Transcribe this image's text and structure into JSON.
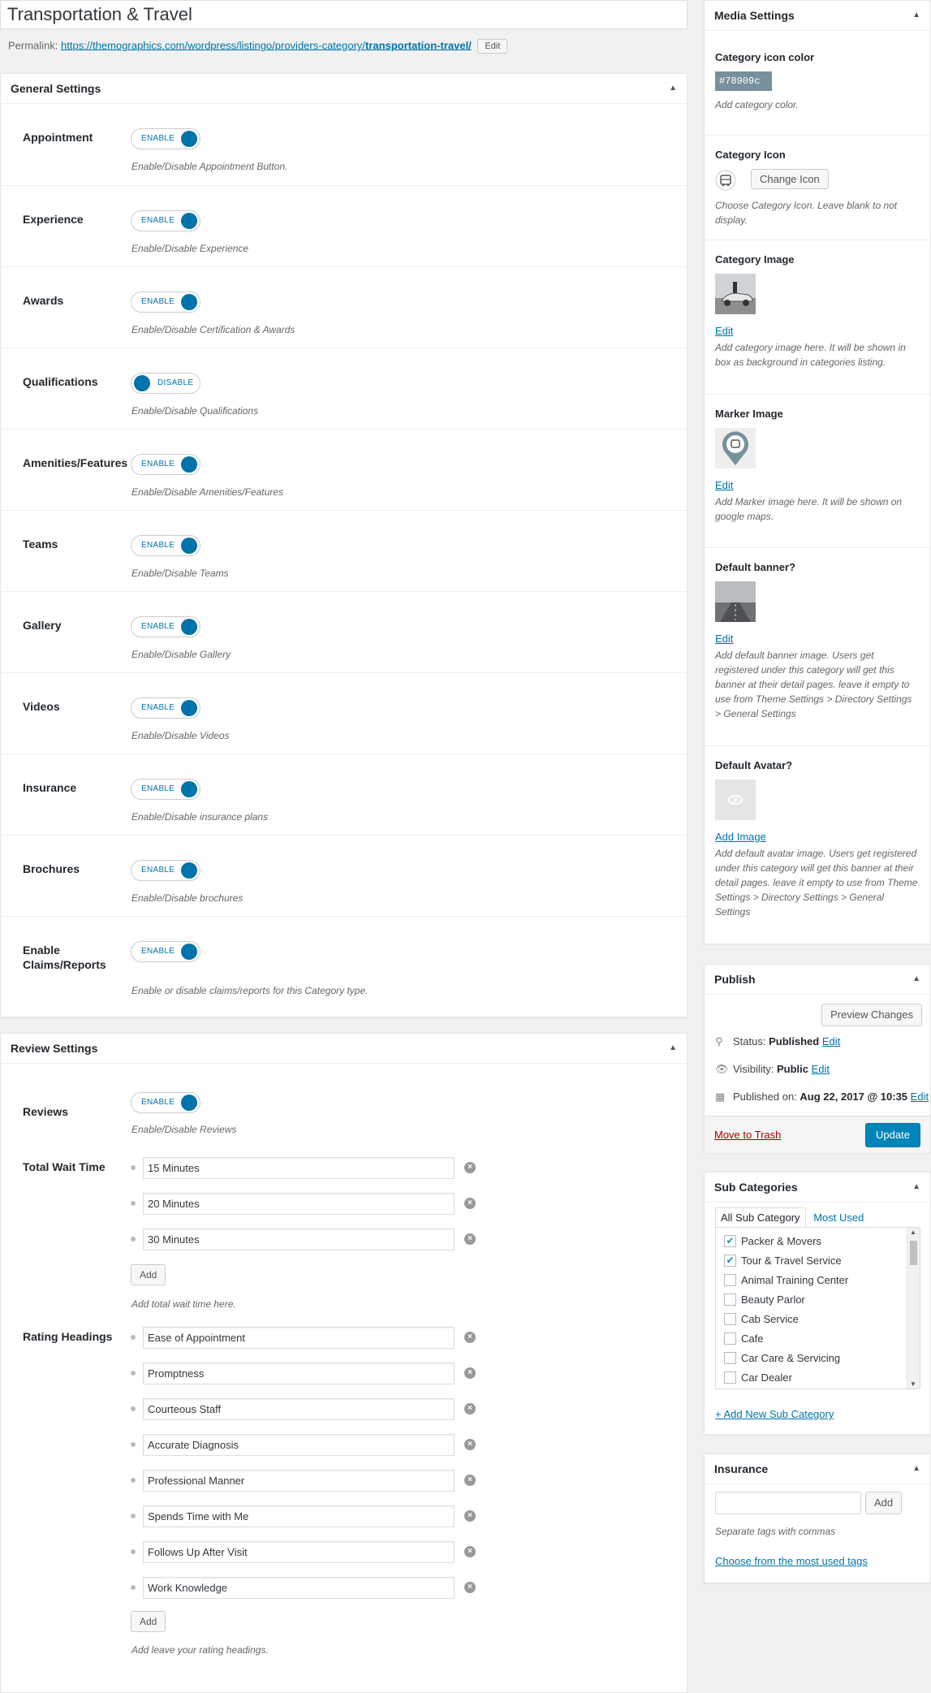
{
  "title": "Transportation & Travel",
  "permalink": {
    "label": "Permalink:",
    "url_base": "https://themographics.com/wordpress/listingo/providers-category/",
    "url_slug": "transportation-travel/",
    "edit_label": "Edit"
  },
  "general_settings": {
    "title": "General Settings",
    "rows": [
      {
        "label": "Appointment",
        "state": "ENABLE",
        "desc": "Enable/Disable Appointment Button."
      },
      {
        "label": "Experience",
        "state": "ENABLE",
        "desc": "Enable/Disable Experience"
      },
      {
        "label": "Awards",
        "state": "ENABLE",
        "desc": "Enable/Disable Certification & Awards"
      },
      {
        "label": "Qualifications",
        "state": "DISABLE",
        "desc": "Enable/Disable Qualifications"
      },
      {
        "label": "Amenities/Features",
        "state": "ENABLE",
        "desc": "Enable/Disable Amenities/Features"
      },
      {
        "label": "Teams",
        "state": "ENABLE",
        "desc": "Enable/Disable Teams"
      },
      {
        "label": "Gallery",
        "state": "ENABLE",
        "desc": "Enable/Disable Gallery"
      },
      {
        "label": "Videos",
        "state": "ENABLE",
        "desc": "Enable/Disable Videos"
      },
      {
        "label": "Insurance",
        "state": "ENABLE",
        "desc": "Enable/Disable insurance plans"
      },
      {
        "label": "Brochures",
        "state": "ENABLE",
        "desc": "Enable/Disable brochures"
      },
      {
        "label": "Enable Claims/Reports",
        "state": "ENABLE",
        "desc": "Enable or disable claims/reports for this Category type."
      }
    ]
  },
  "review_settings": {
    "title": "Review Settings",
    "reviews": {
      "label": "Reviews",
      "state": "ENABLE",
      "desc": "Enable/Disable Reviews"
    },
    "wait_time": {
      "label": "Total Wait Time",
      "items": [
        "15 Minutes",
        "20 Minutes",
        "30 Minutes"
      ],
      "add_label": "Add",
      "desc": "Add total wait time here."
    },
    "rating_headings": {
      "label": "Rating Headings",
      "items": [
        "Ease of Appointment",
        "Promptness",
        "Courteous Staff",
        "Accurate Diagnosis",
        "Professional Manner",
        "Spends Time with Me",
        "Follows Up After Visit",
        "Work Knowledge"
      ],
      "add_label": "Add",
      "desc": "Add leave your rating headings."
    }
  },
  "media_settings": {
    "title": "Media Settings",
    "icon_color": {
      "label": "Category icon color",
      "value": "#78909c",
      "desc": "Add category color."
    },
    "icon": {
      "label": "Category Icon",
      "button": "Change Icon",
      "desc": "Choose Category Icon. Leave blank to not display."
    },
    "image": {
      "label": "Category Image",
      "link": "Edit",
      "desc": "Add category image here. It will be shown in box as background in categories listing."
    },
    "marker": {
      "label": "Marker Image",
      "link": "Edit",
      "desc": "Add Marker image here. It will be shown on google maps."
    },
    "banner": {
      "label": "Default banner?",
      "link": "Edit",
      "desc": "Add default banner image. Users get registered under this category will get this banner at their detail pages. leave it empty to use from Theme Settings > Directory Settings > General Settings"
    },
    "avatar": {
      "label": "Default Avatar?",
      "link": "Add Image",
      "desc": "Add default avatar image. Users get registered under this category will get this banner at their detail pages. leave it empty to use from Theme Settings > Directory Settings > General Settings"
    }
  },
  "publish": {
    "title": "Publish",
    "preview": "Preview Changes",
    "status_label": "Status:",
    "status_value": "Published",
    "status_edit": "Edit",
    "visibility_label": "Visibility:",
    "visibility_value": "Public",
    "visibility_edit": "Edit",
    "published_label": "Published on:",
    "published_value": "Aug 22, 2017 @ 10:35",
    "published_edit": "Edit",
    "trash": "Move to Trash",
    "update": "Update"
  },
  "sub_categories": {
    "title": "Sub Categories",
    "tab_all": "All Sub Category",
    "tab_used": "Most Used",
    "items": [
      {
        "label": "Packer & Movers",
        "checked": true
      },
      {
        "label": "Tour & Travel Service",
        "checked": true
      },
      {
        "label": "Animal Training Center",
        "checked": false
      },
      {
        "label": "Beauty Parlor",
        "checked": false
      },
      {
        "label": "Cab Service",
        "checked": false
      },
      {
        "label": "Cafe",
        "checked": false
      },
      {
        "label": "Car Care & Servicing",
        "checked": false
      },
      {
        "label": "Car Dealer",
        "checked": false
      }
    ],
    "add_new": "+ Add New Sub Category"
  },
  "insurance": {
    "title": "Insurance",
    "add_label": "Add",
    "hint": "Separate tags with commas",
    "choose_link": "Choose from the most used tags"
  },
  "colors": {
    "accent": "#0073aa",
    "update_bg": "#0085ba",
    "trash": "#a00"
  }
}
